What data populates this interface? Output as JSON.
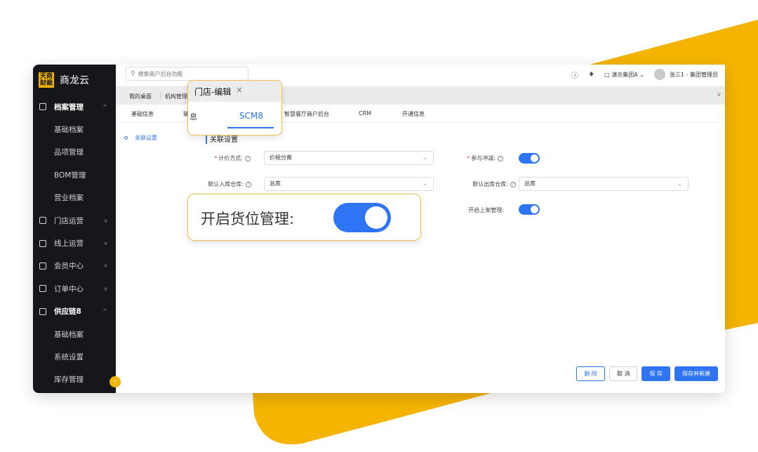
{
  "colors": {
    "accent": "#2f74f5",
    "brand_yellow": "#f5b400",
    "sidebar_bg": "#16171b"
  },
  "sidebar": {
    "logo_text": "天商财裁",
    "brand": "商龙云",
    "items": [
      {
        "label": "档案管理",
        "icon": "archive-icon",
        "expanded": true
      },
      {
        "label": "基础档案"
      },
      {
        "label": "品项管理"
      },
      {
        "label": "BOM管理"
      },
      {
        "label": "营业档案"
      },
      {
        "label": "门店运营",
        "icon": "store-icon"
      },
      {
        "label": "线上运营",
        "icon": "online-icon"
      },
      {
        "label": "会员中心",
        "icon": "member-icon"
      },
      {
        "label": "订单中心",
        "icon": "order-icon"
      },
      {
        "label": "供应链8",
        "icon": "truck-icon",
        "expanded": true
      },
      {
        "label": "基础档案"
      },
      {
        "label": "系统设置"
      },
      {
        "label": "库存管理"
      }
    ]
  },
  "topbar": {
    "search_placeholder": "搜索商户后台功能",
    "org": "演示集团A",
    "user": "张三1 - 集团管理员"
  },
  "tabs": {
    "desktop": "我的桌面",
    "org_manage": "机构管理"
  },
  "subtabs": {
    "basic": "基础信息",
    "hidden": "辅",
    "smart": "智慧餐厅商户后台",
    "crm": "CRM",
    "open": "开通信息"
  },
  "content": {
    "side_link": "关联设置",
    "section_title": "关联设置",
    "pricing_label": "计价方式:",
    "pricing_value": "价税分离",
    "offset_label": "参与冲减:",
    "in_wh_label": "默认入库仓库:",
    "in_wh_value": "总库",
    "out_wh_label": "默认出库仓库:",
    "out_wh_value": "总库",
    "shelf_label": "开启上架管理:"
  },
  "buttons": {
    "delete": "删 除",
    "cancel": "取 消",
    "save": "保 存",
    "save_new": "保存并新建"
  },
  "callout_tab": {
    "title": "门店-编辑",
    "close": "×",
    "left_tab": "息",
    "active_tab": "SCM8"
  },
  "callout_switch": {
    "label": "开启货位管理:",
    "on": true
  }
}
